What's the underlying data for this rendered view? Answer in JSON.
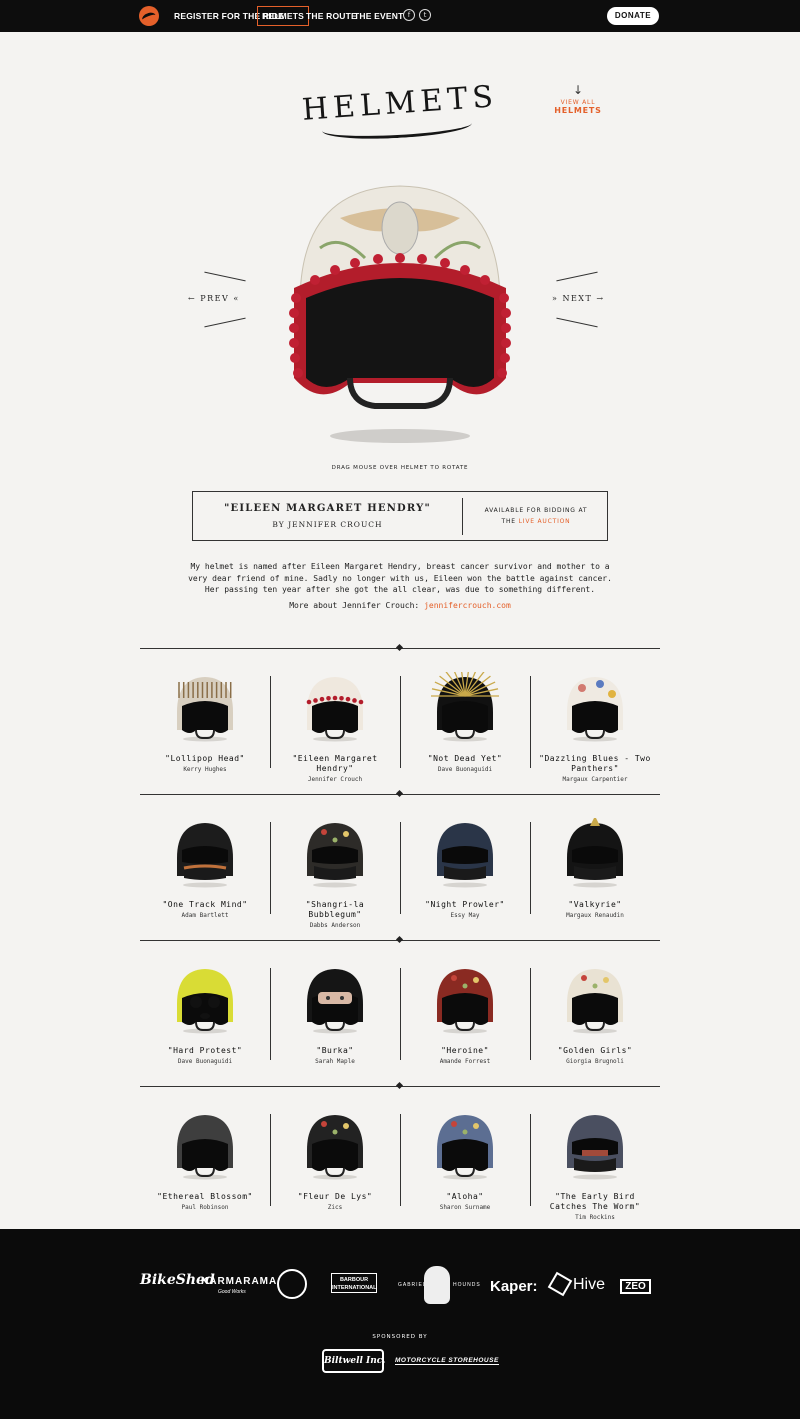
{
  "nav": {
    "items": [
      "REGISTER FOR THE RIDE",
      "HELMETS",
      "THE ROUTE",
      "THE EVENT"
    ],
    "active": "HELMETS",
    "facebook": "f",
    "twitter": "t",
    "donate": "DONATE"
  },
  "page": {
    "title": "HELMETS",
    "view_all_line1": "VIEW ALL",
    "view_all_line2": "HELMETS"
  },
  "hero": {
    "prev": "PREV",
    "next": "NEXT",
    "rotate_hint": "DRAG MOUSE OVER HELMET TO ROTATE"
  },
  "featured": {
    "name": "\"EILEEN MARGARET HENDRY\"",
    "by": "BY JENNIFER CROUCH",
    "available": "AVAILABLE FOR BIDDING AT",
    "auction_prefix": "THE",
    "auction_link": "LIVE AUCTION",
    "description": "My helmet is named after Eileen Margaret Hendry, breast cancer survivor and mother to a very dear friend of mine. Sadly no longer with us, Eileen won the battle against cancer. Her passing ten year after she got the all clear, was due to something different.",
    "more_label": "More about Jennifer Crouch:",
    "more_link": "jennifercrouch.com"
  },
  "helmets": [
    {
      "name": "\"Lollipop Head\"",
      "artist": "Kerry Hughes"
    },
    {
      "name": "\"Eileen Margaret Hendry\"",
      "artist": "Jennifer Crouch"
    },
    {
      "name": "\"Not Dead Yet\"",
      "artist": "Dave Buonaguidi"
    },
    {
      "name": "\"Dazzling Blues - Two Panthers\"",
      "artist": "Margaux Carpentier"
    },
    {
      "name": "\"One Track Mind\"",
      "artist": "Adam Bartlett"
    },
    {
      "name": "\"Shangri-la Bubblegum\"",
      "artist": "Dabbs Anderson"
    },
    {
      "name": "\"Night Prowler\"",
      "artist": "Essy May"
    },
    {
      "name": "\"Valkyrie\"",
      "artist": "Margaux Renaudin"
    },
    {
      "name": "\"Hard Protest\"",
      "artist": "Dave Buonaguidi"
    },
    {
      "name": "\"Burka\"",
      "artist": "Sarah Maple"
    },
    {
      "name": "\"Heroine\"",
      "artist": "Amande Forrest"
    },
    {
      "name": "\"Golden Girls\"",
      "artist": "Giorgia Brugnoli"
    },
    {
      "name": "\"Ethereal Blossom\"",
      "artist": "Paul Robinson"
    },
    {
      "name": "\"Fleur De Lys\"",
      "artist": "Zics"
    },
    {
      "name": "\"Aloha\"",
      "artist": "Sharon Surname"
    },
    {
      "name": "\"The Early Bird Catches The Worm\"",
      "artist": "Tim Rockins"
    }
  ],
  "footer": {
    "partners": [
      "BikeShed",
      "KARMARAMA",
      "Good Works",
      "BARBOUR INTERNATIONAL",
      "GABRIEL",
      "HOUNDS",
      "Kaper:",
      "Hive",
      "ZEO"
    ],
    "sponsored_by": "SPONSORED BY",
    "sponsors": [
      "Biltwell Inc.",
      "MOTORCYCLE STOREHOUSE"
    ]
  },
  "colors": {
    "accent": "#e4602a",
    "background": "#f4f3f1",
    "bar": "#0d0d0d"
  }
}
